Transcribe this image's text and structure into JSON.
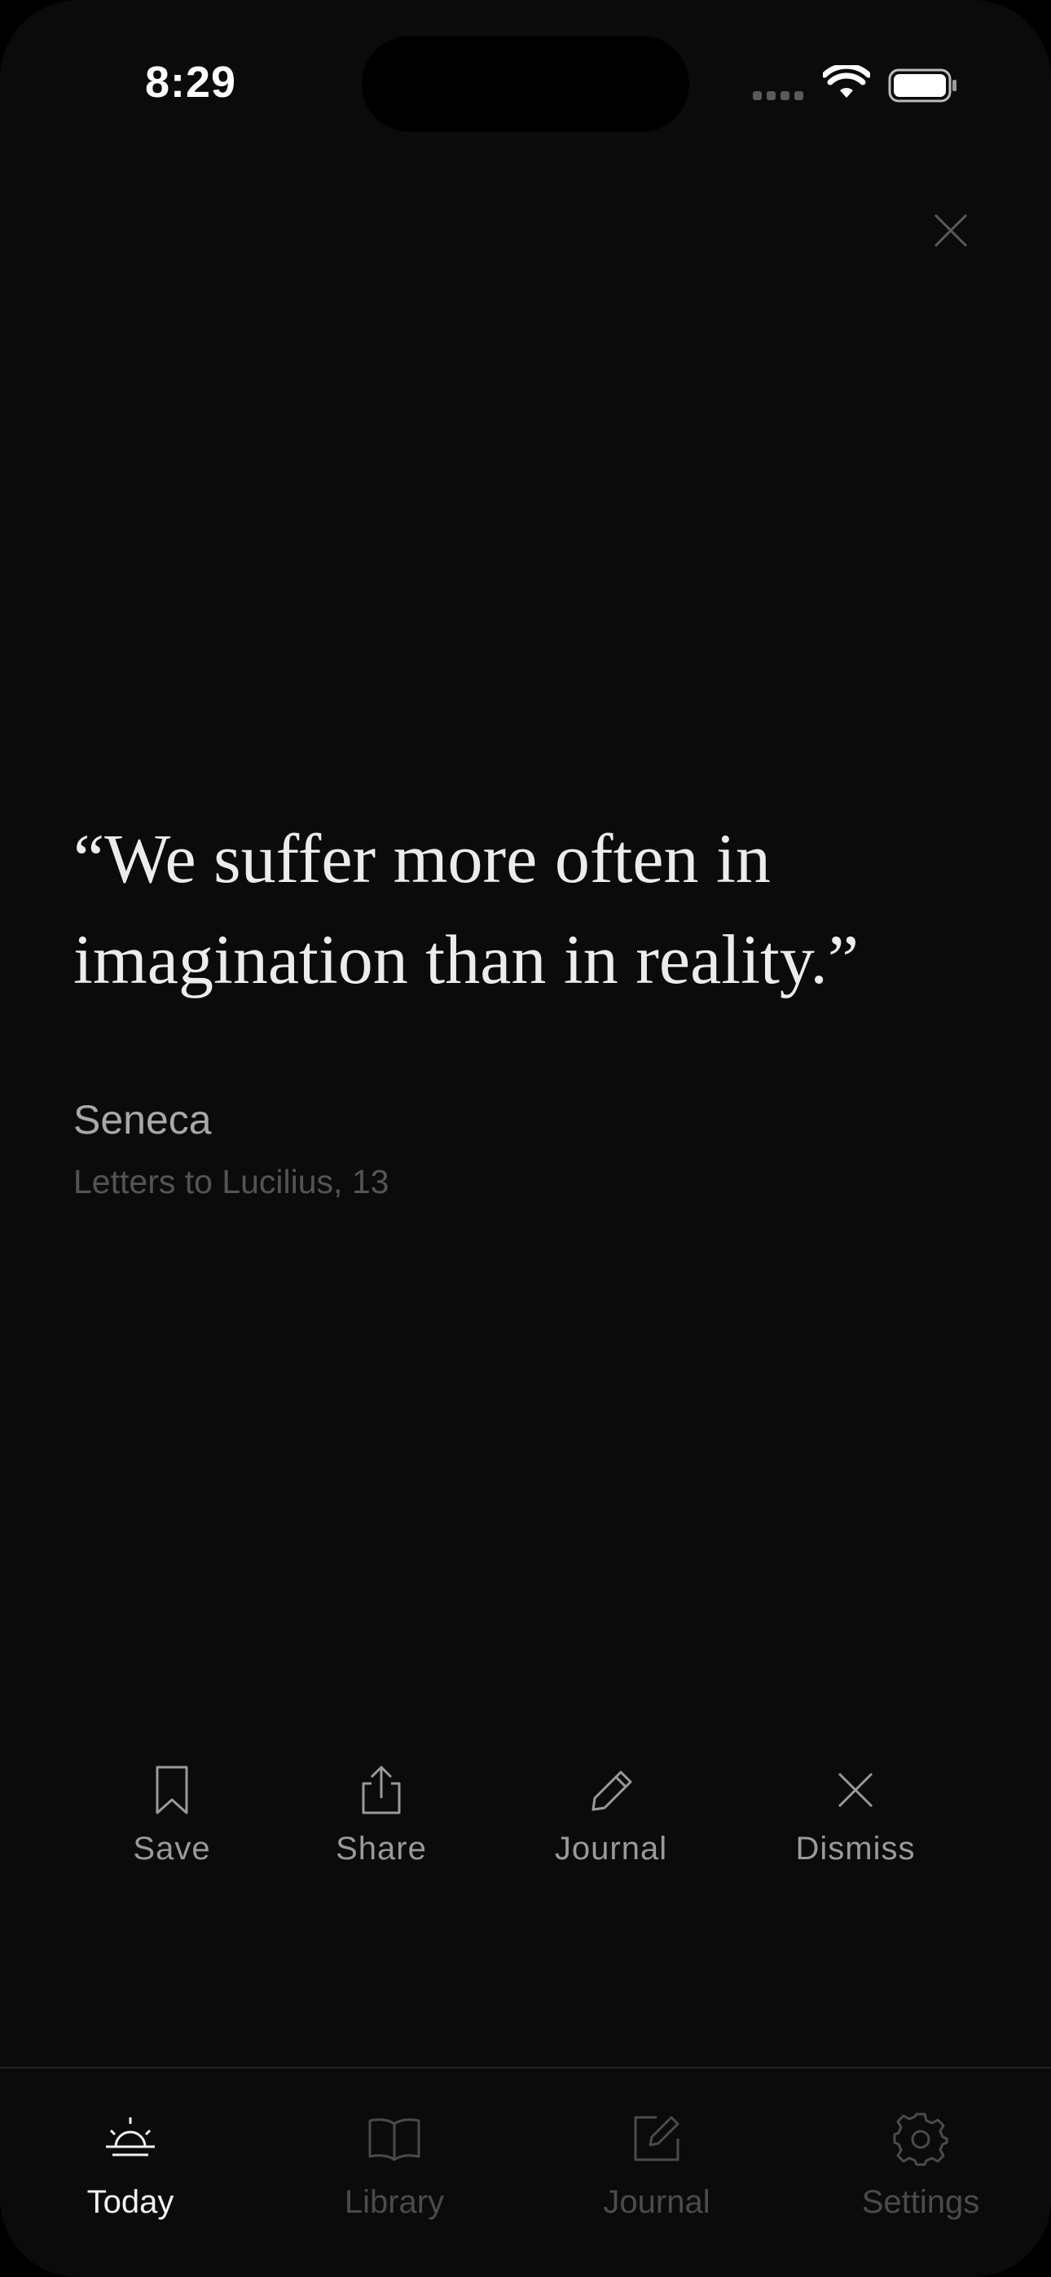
{
  "status_bar": {
    "time": "8:29"
  },
  "quote": {
    "text": "“We suffer more often in imagination than in reality.”",
    "author": "Seneca",
    "source": "Letters to Lucilius, 13"
  },
  "actions": [
    {
      "label": "Save",
      "icon": "bookmark-icon"
    },
    {
      "label": "Share",
      "icon": "share-icon"
    },
    {
      "label": "Journal",
      "icon": "pencil-icon"
    },
    {
      "label": "Dismiss",
      "icon": "x-icon"
    }
  ],
  "tabs": [
    {
      "label": "Today",
      "icon": "sunrise-icon",
      "active": true
    },
    {
      "label": "Library",
      "icon": "book-icon",
      "active": false
    },
    {
      "label": "Journal",
      "icon": "edit-square-icon",
      "active": false
    },
    {
      "label": "Settings",
      "icon": "gear-icon",
      "active": false
    }
  ],
  "colors": {
    "background": "#0b0b0b",
    "quote_text": "#ececec",
    "author_text": "#a8a8a8",
    "source_text": "#545454",
    "action_icon": "#9a9a9a",
    "tab_active": "#f2f2f2",
    "tab_inactive": "#4b4b4b"
  }
}
